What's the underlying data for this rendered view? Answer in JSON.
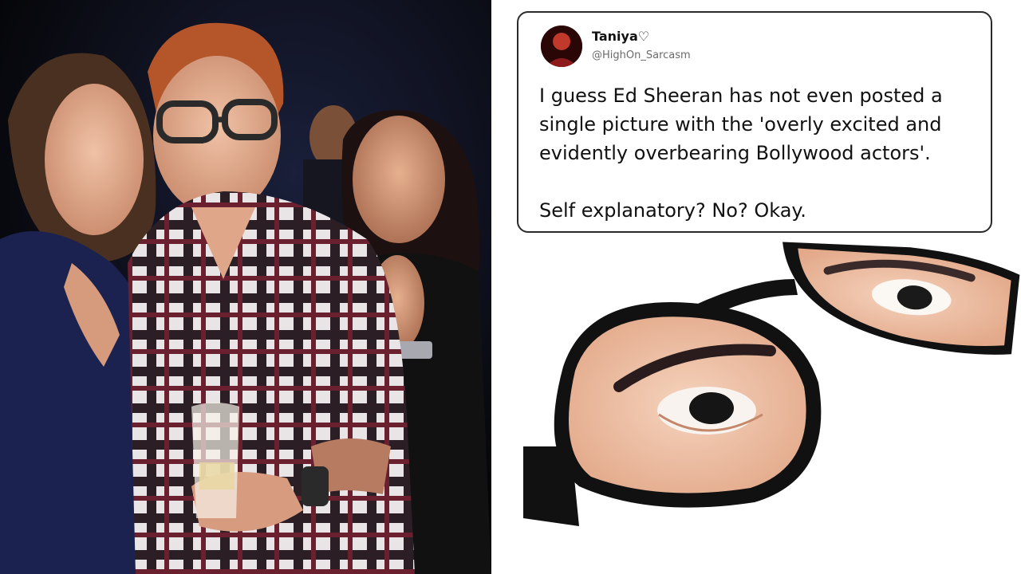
{
  "tweet": {
    "author_name": "Taniya♡",
    "handle": "@HighOn_Sarcasm",
    "text": "I guess Ed Sheeran has not even posted a single picture with the 'overly excited and evidently overbearing Bollywood actors'.\n\nSelf explanatory? No? Okay."
  },
  "colors": {
    "tweet_border": "#2b2b2b",
    "tweet_text": "#111111",
    "handle_text": "#6b6b6b",
    "photo_background": "#0b0b0f",
    "page_background": "#ffffff"
  }
}
